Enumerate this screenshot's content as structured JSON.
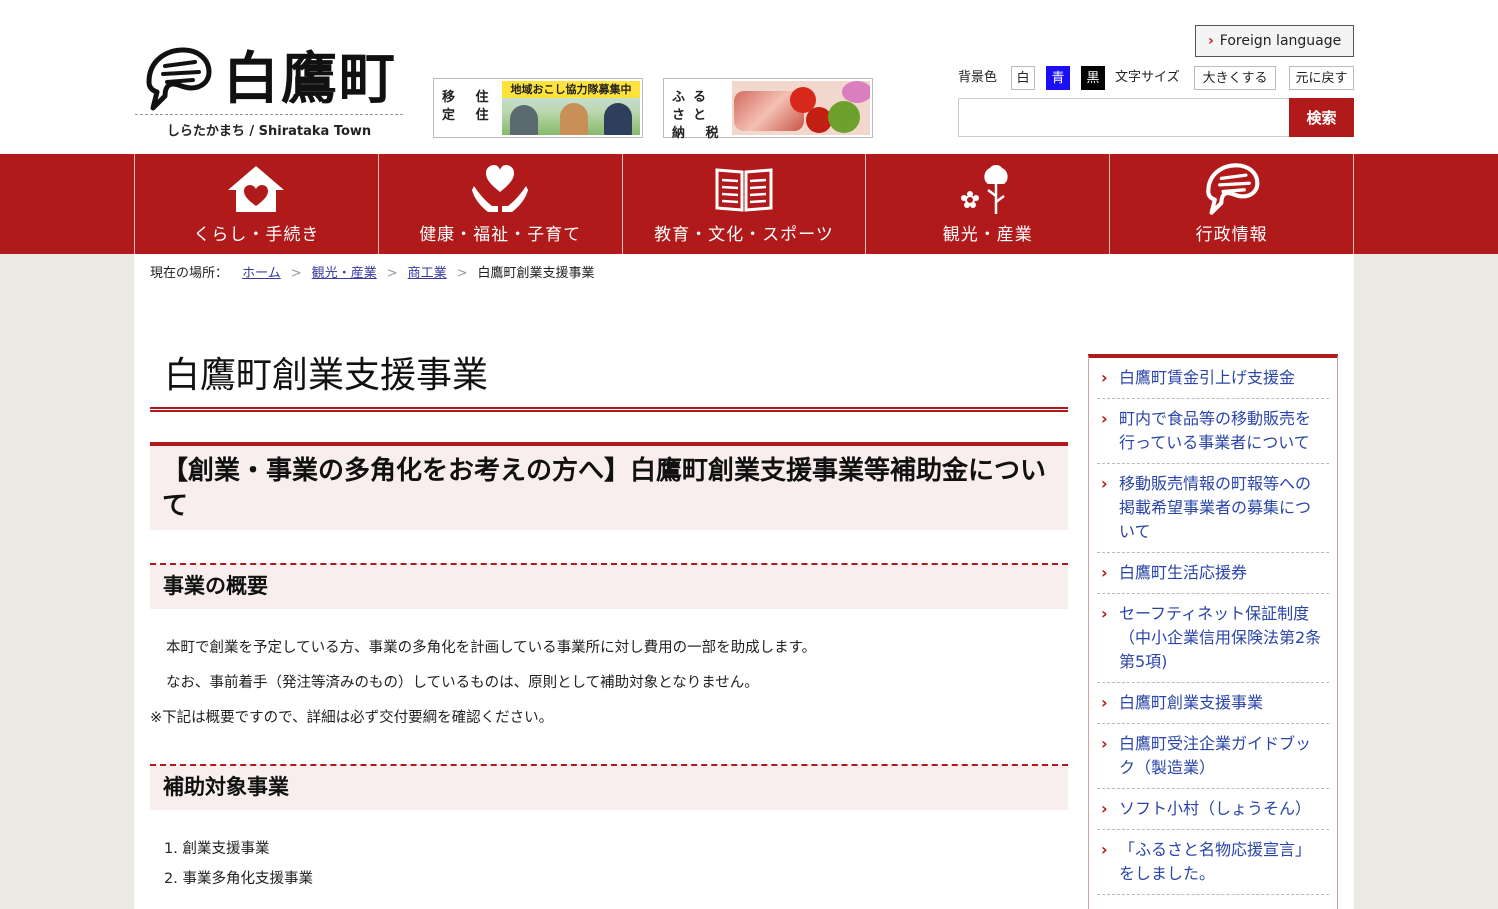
{
  "header": {
    "logo_name": "白鷹町",
    "logo_sub": "しらたかまち / Shirataka Town",
    "banners": [
      {
        "text": "移 住 定 住",
        "tag": "地域おこし協力隊募集中"
      },
      {
        "text": "ふるさと 納 税"
      }
    ],
    "foreign_language": "Foreign language",
    "bg_label": "背景色",
    "bg_white": "白",
    "bg_blue": "青",
    "bg_black": "黒",
    "size_label": "文字サイズ",
    "size_up": "大きくする",
    "size_reset": "元に戻す",
    "search_placeholder": "",
    "search_button": "検索",
    "colors": {
      "brand": "#b01a1a",
      "bg_blue": "#1a0ff5",
      "link": "#2a45a8"
    }
  },
  "nav": [
    {
      "label": "くらし・手続き",
      "icon": "house-heart-icon"
    },
    {
      "label": "健康・福祉・子育て",
      "icon": "hands-heart-icon"
    },
    {
      "label": "教育・文化・スポーツ",
      "icon": "open-book-icon"
    },
    {
      "label": "観光・産業",
      "icon": "flower-icon"
    },
    {
      "label": "行政情報",
      "icon": "town-mark-icon"
    }
  ],
  "breadcrumb": {
    "label": "現在の場所：",
    "items": [
      "ホーム",
      "観光・産業",
      "商工業"
    ],
    "current": "白鷹町創業支援事業"
  },
  "main": {
    "title": "白鷹町創業支援事業",
    "h2": "【創業・事業の多角化をお考えの方へ】白鷹町創業支援事業等補助金について",
    "sections": [
      {
        "heading": "事業の概要",
        "paragraphs": [
          "本町で創業を予定している方、事業の多角化を計画している事業所に対し費用の一部を助成します。",
          "なお、事前着手（発注等済みのもの）しているものは、原則として補助対象となりません。",
          "※下記は概要ですので、詳細は必ず交付要綱を確認ください。"
        ]
      },
      {
        "heading": "補助対象事業",
        "list": [
          "1. 創業支援事業",
          "2. 事業多角化支援事業"
        ]
      }
    ]
  },
  "sidebar": {
    "items": [
      "白鷹町賃金引上げ支援金",
      "町内で食品等の移動販売を行っている事業者について",
      "移動販売情報の町報等への掲載希望事業者の募集について",
      "白鷹町生活応援券",
      "セーフティネット保証制度（中小企業信用保険法第2条第5項)",
      "白鷹町創業支援事業",
      "白鷹町受注企業ガイドブック（製造業）",
      "ソフト小村（しょうそん）",
      "「ふるさと名物応援宣言」をしました。"
    ]
  }
}
